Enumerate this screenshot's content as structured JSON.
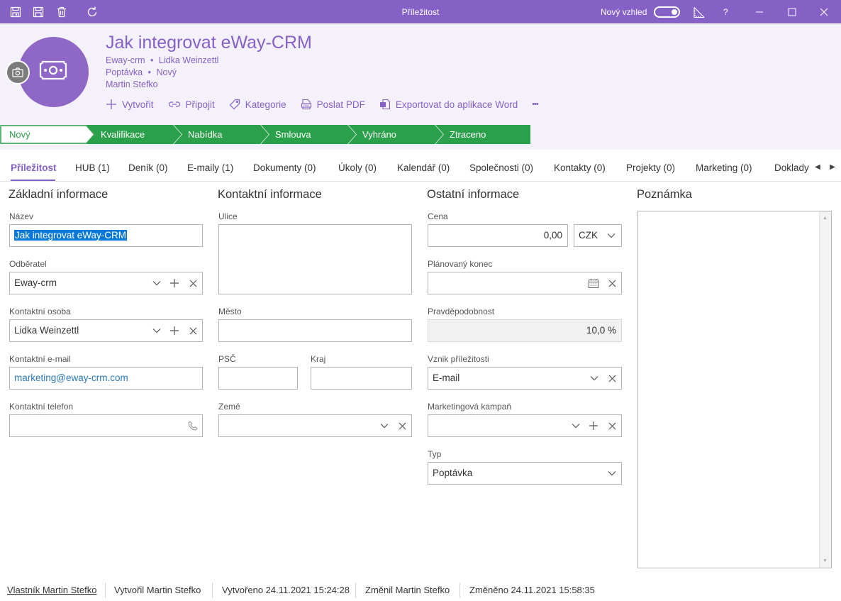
{
  "window": {
    "title": "Příležitost",
    "new_look_label": "Nový vzhled",
    "help_label": "?"
  },
  "header": {
    "title": "Jak integrovat eWay-CRM",
    "company": "Eway-crm",
    "contact": "Lidka Weinzettl",
    "type": "Poptávka",
    "state": "Nový",
    "owner": "Martin Stefko",
    "dot": "•"
  },
  "actions": [
    {
      "label": "Vytvořit",
      "icon": "plus-icon"
    },
    {
      "label": "Připojit",
      "icon": "link-icon"
    },
    {
      "label": "Kategorie",
      "icon": "tag-icon"
    },
    {
      "label": "Poslat PDF",
      "icon": "pdf-icon"
    },
    {
      "label": "Exportovat do aplikace Word",
      "icon": "word-icon"
    }
  ],
  "more_label": "•••",
  "stages": [
    "Nový",
    "Kvalifikace",
    "Nabídka",
    "Smlouva",
    "Vyhráno",
    "Ztraceno"
  ],
  "tabs": [
    "Příležitost",
    "HUB (1)",
    "Deník (0)",
    "E-maily (1)",
    "Dokumenty (0)",
    "Úkoly (0)",
    "Kalendář (0)",
    "Společnosti (0)",
    "Kontakty (0)",
    "Projekty (0)",
    "Marketing (0)",
    "Doklady"
  ],
  "basic": {
    "title": "Základní informace",
    "name_label": "Název",
    "name_value": "Jak integrovat eWay-CRM",
    "customer_label": "Odběratel",
    "customer_value": "Eway-crm",
    "contact_label": "Kontaktní osoba",
    "contact_value": "Lidka Weinzettl",
    "email_label": "Kontaktní e-mail",
    "email_value": "marketing@eway-crm.com",
    "phone_label": "Kontaktní telefon",
    "phone_value": ""
  },
  "contact_info": {
    "title": "Kontaktní informace",
    "street_label": "Ulice",
    "city_label": "Město",
    "zip_label": "PSČ",
    "region_label": "Kraj",
    "country_label": "Země"
  },
  "other": {
    "title": "Ostatní informace",
    "price_label": "Cena",
    "price_value": "0,00",
    "currency_value": "CZK",
    "end_label": "Plánovaný konec",
    "probability_label": "Pravděpodobnost",
    "probability_value": "10,0 %",
    "origin_label": "Vznik příležitosti",
    "origin_value": "E-mail",
    "campaign_label": "Marketingová kampaň",
    "type_label": "Typ",
    "type_value": "Poptávka"
  },
  "note": {
    "title": "Poznámka"
  },
  "footer": {
    "owner": "Vlastník Martin Stefko",
    "created_by": "Vytvořil Martin Stefko",
    "created": "Vytvořeno 24.11.2021 15:24:28",
    "changed_by": "Změnil Martin Stefko",
    "changed": "Změněno 24.11.2021 15:58:35"
  },
  "colors": {
    "accent": "#8661c5",
    "stage_green": "#2aa04a"
  }
}
